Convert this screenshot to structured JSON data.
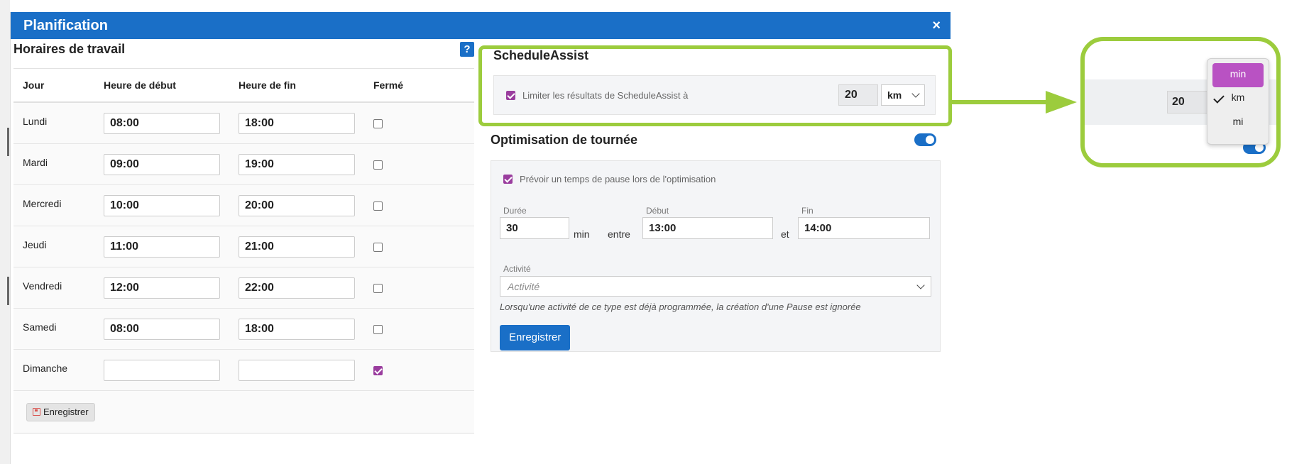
{
  "modal": {
    "title": "Planification",
    "close_symbol": "×"
  },
  "work_hours": {
    "title": "Horaires de travail",
    "help_symbol": "?",
    "columns": {
      "day": "Jour",
      "start": "Heure de début",
      "end": "Heure de fin",
      "closed": "Fermé"
    },
    "rows": [
      {
        "day": "Lundi",
        "start": "08:00",
        "end": "18:00",
        "closed": false
      },
      {
        "day": "Mardi",
        "start": "09:00",
        "end": "19:00",
        "closed": false
      },
      {
        "day": "Mercredi",
        "start": "10:00",
        "end": "20:00",
        "closed": false
      },
      {
        "day": "Jeudi",
        "start": "11:00",
        "end": "21:00",
        "closed": false
      },
      {
        "day": "Vendredi",
        "start": "12:00",
        "end": "22:00",
        "closed": false
      },
      {
        "day": "Samedi",
        "start": "08:00",
        "end": "18:00",
        "closed": false
      },
      {
        "day": "Dimanche",
        "start": "",
        "end": "",
        "closed": true
      }
    ],
    "save_label": "Enregistrer"
  },
  "schedule_assist": {
    "title": "ScheduleAssist",
    "limit_label": "Limiter les résultats de ScheduleAssist à",
    "limit_checked": true,
    "limit_value": "20",
    "unit_selected": "km"
  },
  "optimisation": {
    "title": "Optimisation de tournée",
    "enabled": true,
    "pause_label": "Prévoir un temps de pause lors de l'optimisation",
    "pause_checked": true,
    "duration_label": "Durée",
    "duration_value": "30",
    "duration_unit": "min",
    "between_label": "entre",
    "start_label": "Début",
    "start_value": "13:00",
    "and_label": "et",
    "end_label": "Fin",
    "end_value": "14:00",
    "activity_label": "Activité",
    "activity_placeholder": "Activité",
    "activity_hint": "Lorsqu'une activité de ce type est déjà programmée, la création d'une Pause est ignorée",
    "save_label": "Enregistrer"
  },
  "zoom_callout": {
    "value": "20",
    "options": [
      "min",
      "km",
      "mi"
    ],
    "highlighted": "min",
    "checked": "km"
  },
  "colors": {
    "header_blue": "#1a6fc7",
    "highlight_green": "#9ccc3d",
    "checkbox_purple": "#9a3d9e",
    "dropdown_highlight": "#b952c3"
  }
}
